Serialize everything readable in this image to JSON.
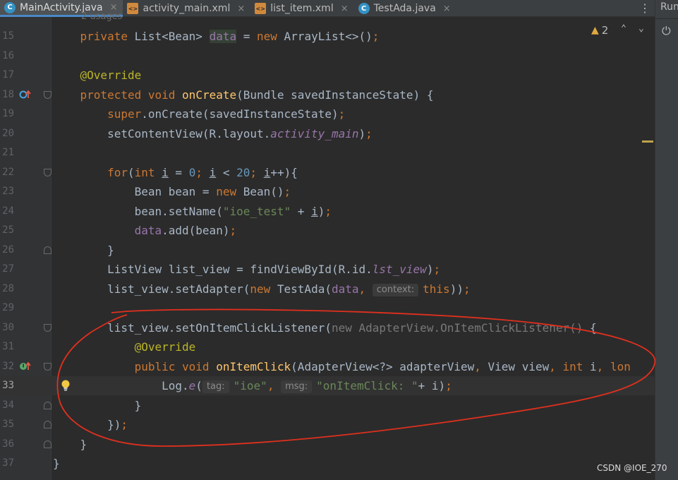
{
  "tabs": [
    {
      "label": "MainActivity.java",
      "kind": "class",
      "glyph": "C",
      "active": true
    },
    {
      "label": "activity_main.xml",
      "kind": "xml",
      "glyph": "<>",
      "active": false
    },
    {
      "label": "list_item.xml",
      "kind": "xml",
      "glyph": "<>",
      "active": false
    },
    {
      "label": "TestAda.java",
      "kind": "class",
      "glyph": "C",
      "active": false
    }
  ],
  "tab_close_glyph": "×",
  "more_glyph": "⋮",
  "run_label": "Run",
  "power_glyph": "⏻",
  "usages": "2 usages",
  "warnings": {
    "count": "2",
    "glyph": "▲"
  },
  "nav_glyphs": {
    "up": "⌃",
    "down": "⌄"
  },
  "watermark": "CSDN @IOE_270",
  "icons": [
    "class-icon",
    "xml-icon",
    "more-vert-icon",
    "power-icon",
    "warning-icon",
    "chevron-up-icon",
    "chevron-down-icon",
    "override-marker-icon",
    "implement-marker-icon",
    "lightbulb-icon",
    "fold-icon"
  ],
  "colors": {
    "keyword": "#cc7832",
    "annotation": "#bbb529",
    "method": "#ffc66d",
    "string": "#6a8759",
    "number": "#6897bb",
    "field": "#9876aa",
    "text": "#a9b7c6",
    "circle": "#e0301e"
  },
  "lines": [
    {
      "n": "15",
      "tokens": [
        [
          "    ",
          ""
        ],
        [
          "private",
          "kw"
        ],
        [
          " List<Bean> ",
          ""
        ],
        [
          "data",
          "fld hl"
        ],
        [
          " = ",
          ""
        ],
        [
          "new",
          "kw"
        ],
        [
          " ArrayList<>()",
          ""
        ],
        [
          ";",
          "kw"
        ]
      ]
    },
    {
      "n": "16",
      "tokens": []
    },
    {
      "n": "17",
      "tokens": [
        [
          "    ",
          ""
        ],
        [
          "@Override",
          "ann"
        ]
      ]
    },
    {
      "n": "18",
      "tokens": [
        [
          "    ",
          ""
        ],
        [
          "protected",
          "kw"
        ],
        [
          " ",
          ""
        ],
        [
          "void",
          "kw"
        ],
        [
          " ",
          ""
        ],
        [
          "onCreate",
          "fn"
        ],
        [
          "(Bundle savedInstanceState) {",
          ""
        ]
      ],
      "marker": "override"
    },
    {
      "n": "19",
      "tokens": [
        [
          "        ",
          ""
        ],
        [
          "super",
          "kw"
        ],
        [
          ".onCreate(savedInstanceState)",
          ""
        ],
        [
          ";",
          "kw"
        ]
      ]
    },
    {
      "n": "20",
      "tokens": [
        [
          "        ",
          ""
        ],
        [
          "setContentView(R.layout.",
          ""
        ],
        [
          "activity_main",
          "ital"
        ],
        [
          ")",
          ""
        ],
        [
          ";",
          "kw"
        ]
      ]
    },
    {
      "n": "21",
      "tokens": []
    },
    {
      "n": "22",
      "tokens": [
        [
          "        ",
          ""
        ],
        [
          "for",
          "kw"
        ],
        [
          "(",
          ""
        ],
        [
          "int",
          "kw"
        ],
        [
          " ",
          ""
        ],
        [
          "i",
          "ul"
        ],
        [
          " = ",
          ""
        ],
        [
          "0",
          "num"
        ],
        [
          "; ",
          "kw"
        ],
        [
          "i",
          "ul"
        ],
        [
          " < ",
          ""
        ],
        [
          "20",
          "num"
        ],
        [
          "; ",
          "kw"
        ],
        [
          "i",
          "ul"
        ],
        [
          "++){",
          ""
        ]
      ]
    },
    {
      "n": "23",
      "tokens": [
        [
          "            ",
          ""
        ],
        [
          "Bean bean = ",
          ""
        ],
        [
          "new",
          "kw"
        ],
        [
          " Bean()",
          ""
        ],
        [
          ";",
          "kw"
        ]
      ]
    },
    {
      "n": "24",
      "tokens": [
        [
          "            ",
          ""
        ],
        [
          "bean.setName(",
          ""
        ],
        [
          "\"ioe_test\"",
          "str"
        ],
        [
          " + ",
          ""
        ],
        [
          "i",
          "ul"
        ],
        [
          ")",
          ""
        ],
        [
          ";",
          "kw"
        ]
      ]
    },
    {
      "n": "25",
      "tokens": [
        [
          "            ",
          ""
        ],
        [
          "data",
          "fld"
        ],
        [
          ".add(bean)",
          ""
        ],
        [
          ";",
          "kw"
        ]
      ]
    },
    {
      "n": "26",
      "tokens": [
        [
          "        ",
          ""
        ],
        [
          "}",
          ""
        ]
      ]
    },
    {
      "n": "27",
      "tokens": [
        [
          "        ",
          ""
        ],
        [
          "ListView list_view = findViewById(R.id.",
          ""
        ],
        [
          "lst_view",
          "ital"
        ],
        [
          ")",
          ""
        ],
        [
          ";",
          "kw"
        ]
      ]
    },
    {
      "n": "28",
      "tokens": [
        [
          "        ",
          ""
        ],
        [
          "list_view.setAdapter(",
          ""
        ],
        [
          "new",
          "kw"
        ],
        [
          " TestAda(",
          ""
        ],
        [
          "data",
          "fld"
        ],
        [
          ", ",
          "kw"
        ],
        [
          "context:",
          "hint"
        ],
        [
          "this",
          "kw"
        ],
        [
          "))",
          ""
        ],
        [
          ";",
          "kw"
        ]
      ]
    },
    {
      "n": "29",
      "tokens": []
    },
    {
      "n": "30",
      "tokens": [
        [
          "        ",
          ""
        ],
        [
          "list_view.setOnItemClickListener(",
          ""
        ],
        [
          "new AdapterView.OnItemClickListener()",
          "grey"
        ],
        [
          " {",
          ""
        ]
      ]
    },
    {
      "n": "31",
      "tokens": [
        [
          "            ",
          ""
        ],
        [
          "@Override",
          "ann"
        ]
      ]
    },
    {
      "n": "32",
      "tokens": [
        [
          "            ",
          ""
        ],
        [
          "public",
          "kw"
        ],
        [
          " ",
          ""
        ],
        [
          "void",
          "kw"
        ],
        [
          " ",
          ""
        ],
        [
          "onItemClick",
          "fn"
        ],
        [
          "(AdapterView<?> adapterView",
          ""
        ],
        [
          ", ",
          "kw"
        ],
        [
          "View view",
          ""
        ],
        [
          ", ",
          "kw"
        ],
        [
          "int",
          "kw"
        ],
        [
          " i",
          ""
        ],
        [
          ", ",
          "kw"
        ],
        [
          "lon",
          "kw"
        ]
      ],
      "marker": "implement"
    },
    {
      "n": "33",
      "tokens": [
        [
          "                ",
          ""
        ],
        [
          "Log.",
          ""
        ],
        [
          "e",
          "ital"
        ],
        [
          "(",
          ""
        ],
        [
          "tag:",
          "hint"
        ],
        [
          "\"ioe\"",
          "str"
        ],
        [
          ", ",
          "kw"
        ],
        [
          "msg:",
          "hint"
        ],
        [
          "\"onItemClick: \"",
          "str"
        ],
        [
          "+ i)",
          ""
        ],
        [
          ";",
          "kw"
        ]
      ],
      "current": true,
      "bulb": true
    },
    {
      "n": "34",
      "tokens": [
        [
          "            ",
          ""
        ],
        [
          "}",
          ""
        ]
      ]
    },
    {
      "n": "35",
      "tokens": [
        [
          "        ",
          ""
        ],
        [
          "})",
          ""
        ],
        [
          ";",
          "kw"
        ]
      ]
    },
    {
      "n": "36",
      "tokens": [
        [
          "    ",
          ""
        ],
        [
          "}",
          ""
        ]
      ]
    },
    {
      "n": "37",
      "tokens": [
        [
          "}",
          ""
        ]
      ]
    }
  ]
}
